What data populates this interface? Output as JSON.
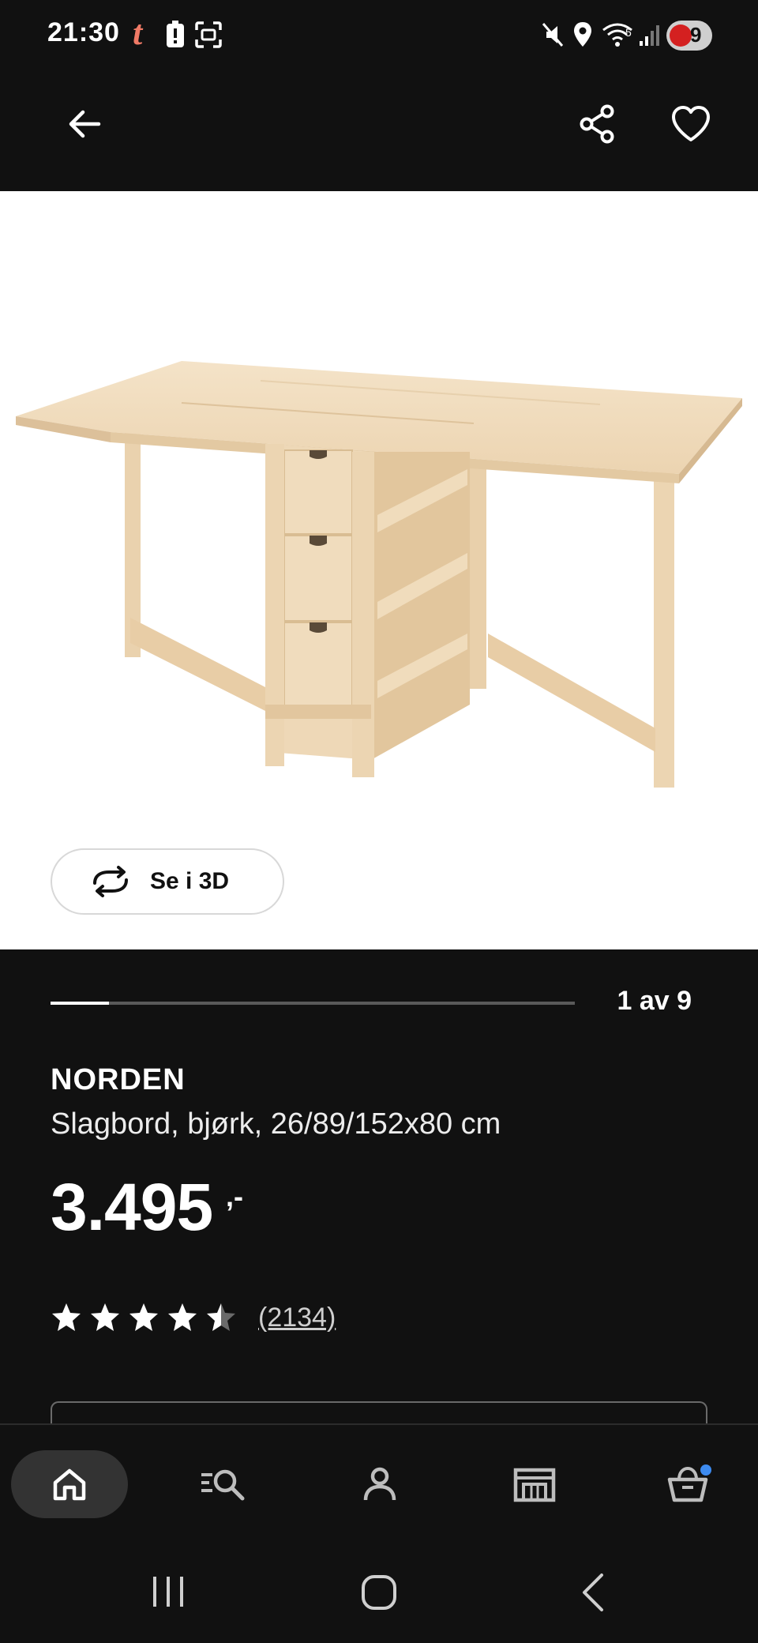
{
  "status_bar": {
    "time": "21:30",
    "app_glyph": "t",
    "battery_level": "9"
  },
  "product": {
    "brand": "NORDEN",
    "description": "Slagbord, bjørk, 26/89/152x80 cm",
    "price": "3.495",
    "price_suffix": ",-",
    "rating": 4.5,
    "max_rating": 5,
    "reviews_count": "(2134)"
  },
  "gallery": {
    "current": 1,
    "total": 9,
    "counter_label": "1 av 9",
    "view_3d_label": "Se i 3D"
  },
  "top_bar": {
    "icons": [
      "back-arrow-icon",
      "share-icon",
      "heart-icon"
    ]
  },
  "bottom_nav": {
    "items": [
      "home",
      "search",
      "profile",
      "store",
      "cart"
    ],
    "active": "home"
  },
  "system_nav": {
    "icons": [
      "recents-icon",
      "home-circle-icon",
      "back-chevron-icon"
    ]
  },
  "colors": {
    "background": "#111111",
    "accent_dot": "#3d8bf0",
    "hero_bg": "#ffffff",
    "wood": "#f1dcbf"
  }
}
